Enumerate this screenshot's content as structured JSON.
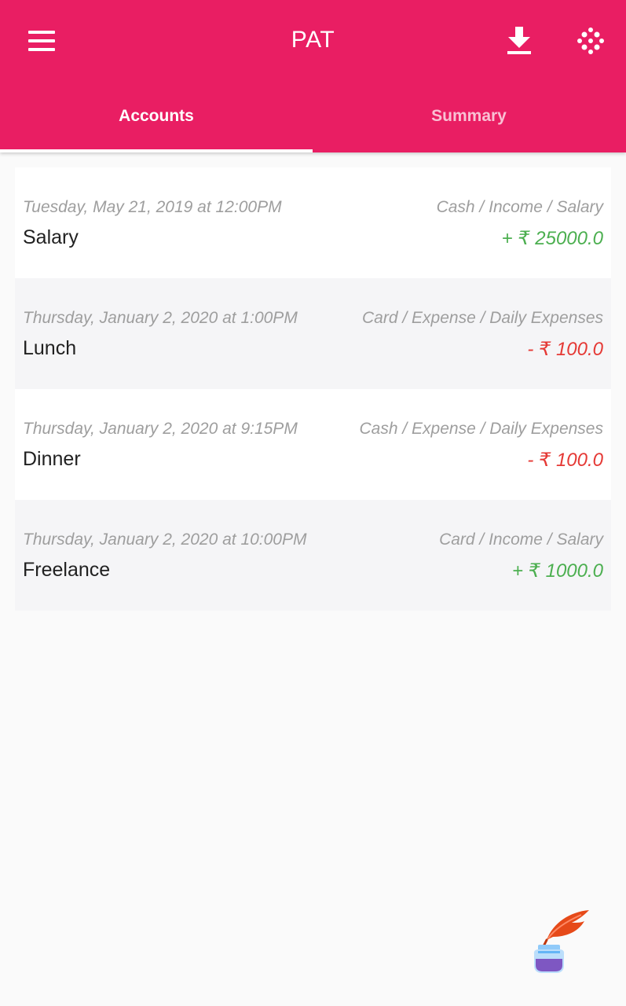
{
  "app": {
    "title": "PAT",
    "colors": {
      "primary": "#e91e63",
      "income": "#4caf50",
      "expense": "#e53935",
      "muted": "#9e9e9e"
    }
  },
  "toolbar": {
    "menu_icon": "hamburger-menu-icon",
    "download_icon": "download-icon",
    "pattern_icon": "dots-pattern-icon"
  },
  "tabs": [
    {
      "label": "Accounts",
      "active": true
    },
    {
      "label": "Summary",
      "active": false
    }
  ],
  "transactions": [
    {
      "date": "Tuesday, May 21, 2019 at 12:00PM",
      "category": "Cash / Income / Salary",
      "title": "Salary",
      "amount": "+ ₹ 25000.0",
      "type": "income"
    },
    {
      "date": "Thursday, January 2, 2020 at 1:00PM",
      "category": "Card / Expense / Daily Expenses",
      "title": "Lunch",
      "amount": "- ₹ 100.0",
      "type": "expense"
    },
    {
      "date": "Thursday, January 2, 2020 at 9:15PM",
      "category": "Cash / Expense / Daily Expenses",
      "title": "Dinner",
      "amount": "- ₹ 100.0",
      "type": "expense"
    },
    {
      "date": "Thursday, January 2, 2020 at 10:00PM",
      "category": "Card / Income / Salary",
      "title": "Freelance",
      "amount": "+ ₹ 1000.0",
      "type": "income"
    }
  ],
  "fab": {
    "icon": "quill-ink-pot-icon"
  }
}
